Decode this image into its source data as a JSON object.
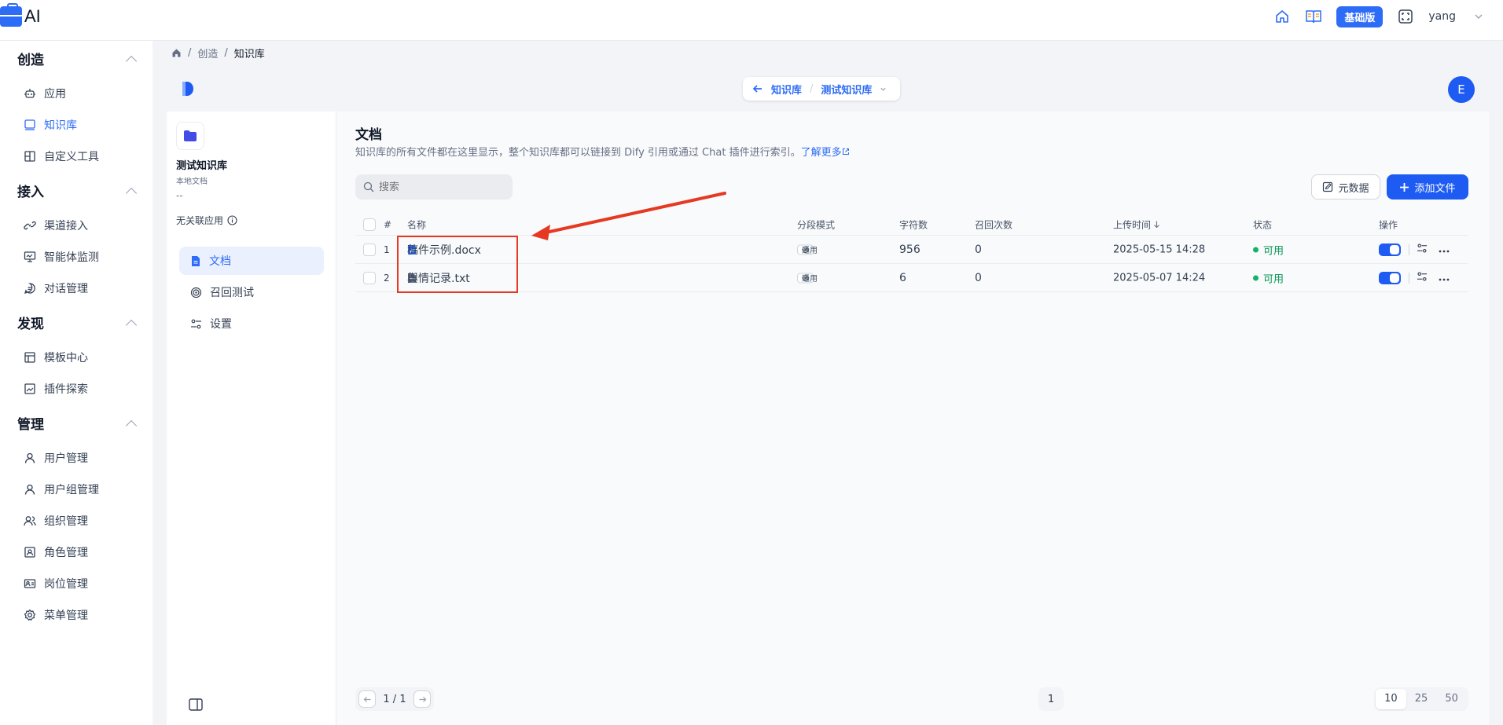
{
  "app": {
    "brand": "AI",
    "plan_badge": "基础版",
    "user": "yang"
  },
  "sidebar": {
    "sections": [
      {
        "title": "创造",
        "items": [
          "应用",
          "知识库",
          "自定义工具"
        ]
      },
      {
        "title": "接入",
        "items": [
          "渠道接入",
          "智能体监测",
          "对话管理"
        ]
      },
      {
        "title": "发现",
        "items": [
          "模板中心",
          "插件探索"
        ]
      },
      {
        "title": "管理",
        "items": [
          "用户管理",
          "用户组管理",
          "组织管理",
          "角色管理",
          "岗位管理",
          "菜单管理"
        ]
      }
    ],
    "active_item": "知识库"
  },
  "breadcrumb": {
    "sep": "/",
    "items": [
      "创造",
      "知识库"
    ]
  },
  "dataset_switch": {
    "back_label": "知识库",
    "sep": "/",
    "current": "测试知识库"
  },
  "avatar_letter": "E",
  "kb": {
    "name": "测试知识库",
    "type": "本地文档",
    "dash": "--",
    "no_app": "无关联应用",
    "nav": [
      "文档",
      "召回测试",
      "设置"
    ],
    "active_nav": "文档"
  },
  "docs": {
    "title": "文档",
    "desc": "知识库的所有文件都在这里显示，整个知识库都可以链接到 Dify 引用或通过 Chat 插件进行索引。",
    "learn_more": "了解更多",
    "search_placeholder": "搜索",
    "btn_meta": "元数据",
    "btn_add": "添加文件",
    "columns": {
      "index": "#",
      "name": "名称",
      "mode": "分段模式",
      "chars": "字符数",
      "hits": "召回次数",
      "upload": "上传时间",
      "status": "状态",
      "action": "操作"
    },
    "rows": [
      {
        "index": "1",
        "name": "稿件示例.docx",
        "mode": "通用",
        "chars": "956",
        "hits": "0",
        "upload": "2025-05-15 14:28",
        "status": "可用",
        "enabled": true
      },
      {
        "index": "2",
        "name": "舆情记录.txt",
        "mode": "通用",
        "chars": "6",
        "hits": "0",
        "upload": "2025-05-07 14:24",
        "status": "可用",
        "enabled": true
      }
    ]
  },
  "pagination": {
    "page_text": "1 / 1",
    "current_page": "1",
    "sizes": [
      "10",
      "25",
      "50"
    ],
    "active_size": "10"
  },
  "colors": {
    "accent": "#2d6cf6",
    "status_ok": "#17b26a",
    "annotation": "#e53922"
  }
}
